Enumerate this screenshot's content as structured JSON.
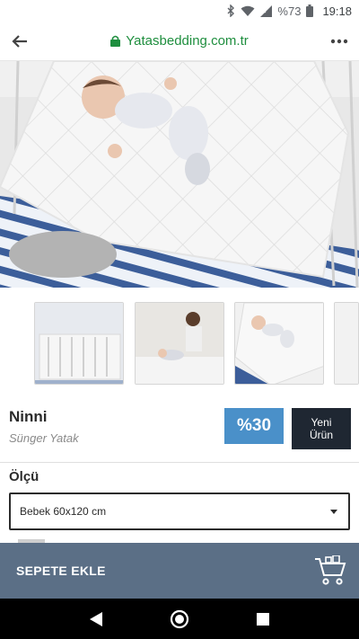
{
  "status_bar": {
    "battery": "%73",
    "time": "19:18",
    "icons": [
      "bluetooth-icon",
      "wifi-icon",
      "signal-icon",
      "battery-icon"
    ]
  },
  "browser": {
    "url": "Yatasbedding.com.tr",
    "icons": [
      "back-arrow-icon",
      "lock-icon",
      "more-icon"
    ]
  },
  "product": {
    "name": "Ninni",
    "subtitle": "Sünger Yatak",
    "discount": "%30",
    "new_badge_line1": "Yeni",
    "new_badge_line2": "Ürün"
  },
  "size": {
    "label": "Ölçü",
    "selected": "Bebek 60x120 cm"
  },
  "cart": {
    "label": "SEPETE EKLE"
  },
  "colors": {
    "url_green": "#1e8e3e",
    "discount_blue": "#4a90c9",
    "badge_dark": "#1f2732",
    "cart_bar": "#5b6f86"
  }
}
